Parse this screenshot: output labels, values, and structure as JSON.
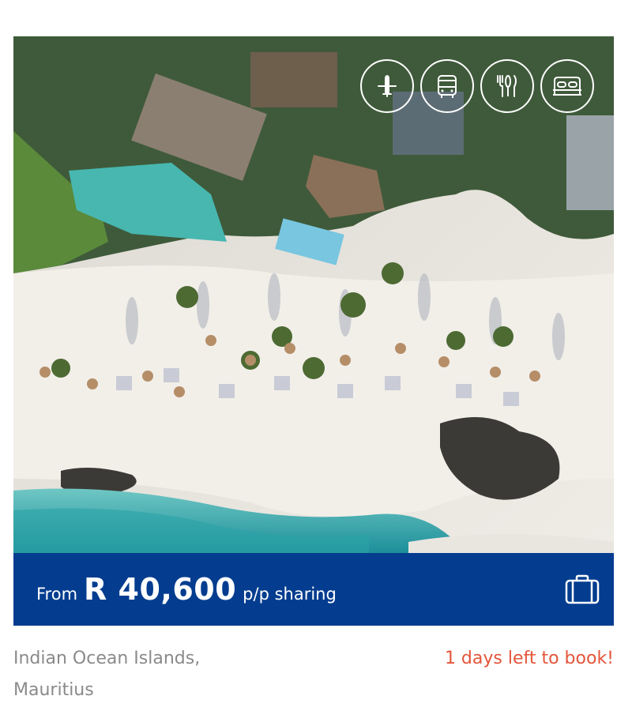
{
  "card": {
    "hero": {
      "alt_description_icons": [
        "flight-icon",
        "bus-transfer-icon",
        "meals-icon",
        "bed-icon"
      ]
    },
    "price": {
      "prefix": "From",
      "amount": "R 40,600",
      "suffix": "p/p sharing",
      "bar_color": "#043d8f"
    },
    "location_line1": "Indian Ocean Islands,",
    "location_line2": "Mauritius",
    "urgency": "1 days left to book!",
    "urgency_color": "#e4553a"
  }
}
